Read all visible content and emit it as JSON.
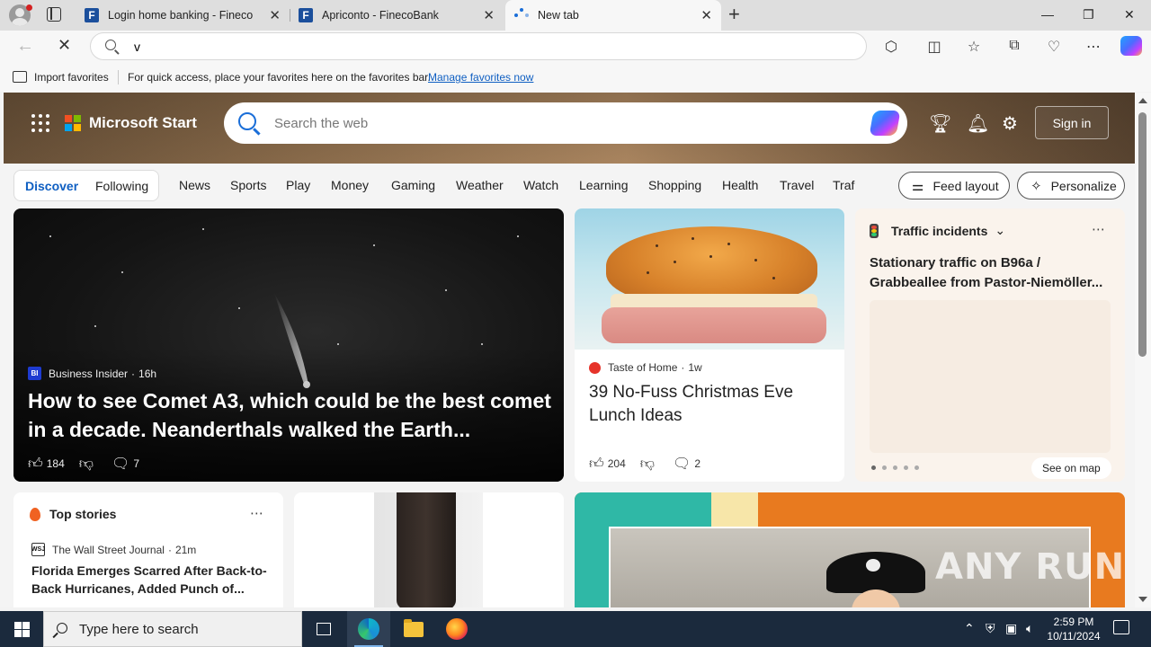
{
  "browser": {
    "tabs": [
      {
        "title": "Login home banking - Fineco",
        "favicon_letter": "F"
      },
      {
        "title": "Apriconto - FinecoBank",
        "favicon_letter": "F"
      },
      {
        "title": "New tab",
        "favicon_letter": ""
      }
    ],
    "address_value": "v",
    "favorites_bar": {
      "import_label": "Import favorites",
      "hint": "For quick access, place your favorites here on the favorites bar.",
      "manage_link": "Manage favorites now"
    }
  },
  "page": {
    "brand": "Microsoft Start",
    "search_placeholder": "Search the web",
    "sign_in": "Sign in",
    "feed_tabs": {
      "discover": "Discover",
      "following": "Following"
    },
    "categories": [
      "News",
      "Sports",
      "Play",
      "Money",
      "Gaming",
      "Weather",
      "Watch",
      "Learning",
      "Shopping",
      "Health",
      "Travel",
      "Traf"
    ],
    "feed_layout": "Feed layout",
    "personalize": "Personalize",
    "hero": {
      "source_logo": "BI",
      "source": "Business Insider",
      "age": "16h",
      "title": "How to see Comet A3, which could be the best comet in a decade. Neanderthals walked the Earth...",
      "likes": "184",
      "comments": "7"
    },
    "food": {
      "source": "Taste of Home",
      "age": "1w",
      "title": "39 No-Fuss Christmas Eve Lunch Ideas",
      "likes": "204",
      "comments": "2"
    },
    "traffic": {
      "heading": "Traffic incidents",
      "title_line1": "Stationary traffic on B96a /",
      "title_line2": "Grabbeallee from Pastor-Niemöller...",
      "see_on_map": "See on map"
    },
    "top_stories": {
      "heading": "Top stories",
      "source_logo": "WSJ",
      "source": "The Wall Street Journal",
      "age": "21m",
      "title": "Florida Emerges Scarred After Back-to-Back Hurricanes, Added Punch of..."
    },
    "watermark": "ANY RUN"
  },
  "taskbar": {
    "search_placeholder": "Type here to search",
    "time": "2:59 PM",
    "date": "10/11/2024"
  }
}
